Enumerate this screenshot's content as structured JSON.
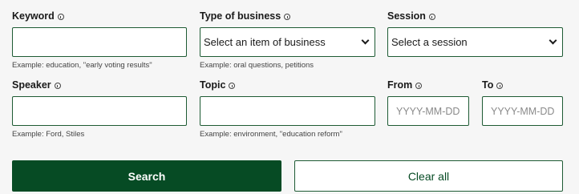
{
  "keyword": {
    "label": "Keyword",
    "value": "",
    "hint": "Example: education, \"early voting results\""
  },
  "business": {
    "label": "Type of business",
    "selected": "Select an item of business",
    "hint": "Example: oral questions, petitions"
  },
  "session": {
    "label": "Session",
    "selected": "Select a session"
  },
  "speaker": {
    "label": "Speaker",
    "value": "",
    "hint": "Example: Ford, Stiles"
  },
  "topic": {
    "label": "Topic",
    "value": "",
    "hint": "Example: environment, \"education reform\""
  },
  "from": {
    "label": "From",
    "placeholder": "YYYY-MM-DD"
  },
  "to": {
    "label": "To",
    "placeholder": "YYYY-MM-DD"
  },
  "buttons": {
    "search": "Search",
    "clear": "Clear all"
  },
  "colors": {
    "primary": "#064b24",
    "border": "#1e5b34",
    "background": "#f6f6f6"
  },
  "icons": {
    "info": "info-circle-icon",
    "dropdown": "chevron-down-icon"
  }
}
